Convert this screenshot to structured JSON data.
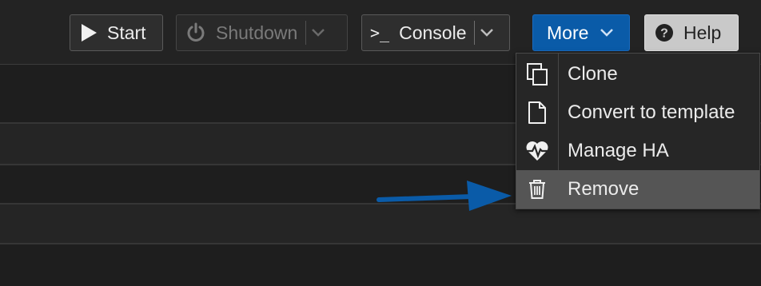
{
  "toolbar": {
    "start_label": "Start",
    "shutdown_label": "Shutdown",
    "console_label": "Console",
    "console_prompt": ">_",
    "more_label": "More",
    "help_label": "Help"
  },
  "more_menu": {
    "items": [
      {
        "label": "Clone",
        "icon": "clone-icon"
      },
      {
        "label": "Convert to template",
        "icon": "file-icon"
      },
      {
        "label": "Manage HA",
        "icon": "heartbeat-icon"
      },
      {
        "label": "Remove",
        "icon": "trash-icon",
        "highlighted": true
      }
    ]
  },
  "annotation": {
    "arrow_color": "#0a5ba8",
    "arrow_target": "Remove"
  },
  "colors": {
    "accent": "#0a5ba8",
    "background": "#1f1f1f",
    "menu_highlight": "#555555"
  }
}
